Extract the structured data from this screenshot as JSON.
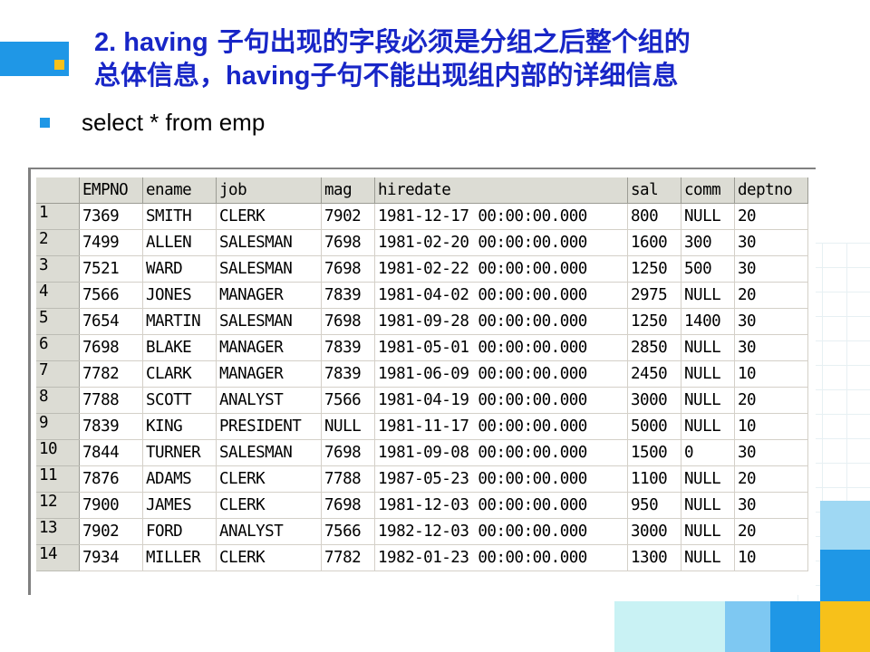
{
  "title": {
    "line1_num": "2. having",
    "line1_rest": " 子句出现的字段必须是分组之后整个组的",
    "line2_a": "总体信息，",
    "line2_b": "having",
    "line2_c": "子句不能出现组内部的详细信息"
  },
  "bullet": "select * from emp",
  "colors": {
    "title": "#1826c7",
    "accent_blue": "#1f97e6",
    "accent_yellow": "#f7c11a"
  },
  "table": {
    "columns": [
      "",
      "EMPNO",
      "ename",
      "job",
      "mag",
      "hiredate",
      "sal",
      "comm",
      "deptno"
    ],
    "rows": [
      [
        "1",
        "7369",
        "SMITH",
        "CLERK",
        "7902",
        "1981-12-17 00:00:00.000",
        "800",
        "NULL",
        "20"
      ],
      [
        "2",
        "7499",
        "ALLEN",
        "SALESMAN",
        "7698",
        "1981-02-20 00:00:00.000",
        "1600",
        "300",
        "30"
      ],
      [
        "3",
        "7521",
        "WARD",
        "SALESMAN",
        "7698",
        "1981-02-22 00:00:00.000",
        "1250",
        "500",
        "30"
      ],
      [
        "4",
        "7566",
        "JONES",
        "MANAGER",
        "7839",
        "1981-04-02 00:00:00.000",
        "2975",
        "NULL",
        "20"
      ],
      [
        "5",
        "7654",
        "MARTIN",
        "SALESMAN",
        "7698",
        "1981-09-28 00:00:00.000",
        "1250",
        "1400",
        "30"
      ],
      [
        "6",
        "7698",
        "BLAKE",
        "MANAGER",
        "7839",
        "1981-05-01 00:00:00.000",
        "2850",
        "NULL",
        "30"
      ],
      [
        "7",
        "7782",
        "CLARK",
        "MANAGER",
        "7839",
        "1981-06-09 00:00:00.000",
        "2450",
        "NULL",
        "10"
      ],
      [
        "8",
        "7788",
        "SCOTT",
        "ANALYST",
        "7566",
        "1981-04-19 00:00:00.000",
        "3000",
        "NULL",
        "20"
      ],
      [
        "9",
        "7839",
        "KING",
        "PRESIDENT",
        "NULL",
        "1981-11-17 00:00:00.000",
        "5000",
        "NULL",
        "10"
      ],
      [
        "10",
        "7844",
        "TURNER",
        "SALESMAN",
        "7698",
        "1981-09-08 00:00:00.000",
        "1500",
        "0",
        "30"
      ],
      [
        "11",
        "7876",
        "ADAMS",
        "CLERK",
        "7788",
        "1987-05-23 00:00:00.000",
        "1100",
        "NULL",
        "20"
      ],
      [
        "12",
        "7900",
        "JAMES",
        "CLERK",
        "7698",
        "1981-12-03 00:00:00.000",
        "950",
        "NULL",
        "30"
      ],
      [
        "13",
        "7902",
        "FORD",
        "ANALYST",
        "7566",
        "1982-12-03 00:00:00.000",
        "3000",
        "NULL",
        "20"
      ],
      [
        "14",
        "7934",
        "MILLER",
        "CLERK",
        "7782",
        "1982-01-23 00:00:00.000",
        "1300",
        "NULL",
        "10"
      ]
    ]
  }
}
